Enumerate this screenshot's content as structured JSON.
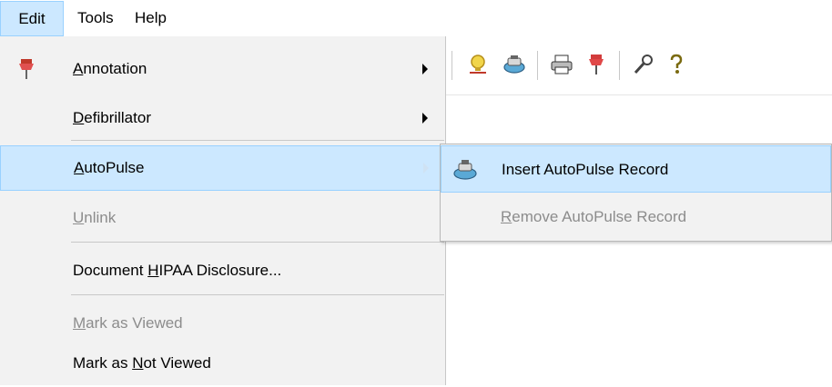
{
  "menubar": {
    "items": [
      {
        "label": "Edit"
      },
      {
        "label": "Tools"
      },
      {
        "label": "Help"
      }
    ]
  },
  "toolbar": {
    "icons": [
      "lamp-icon",
      "autopulse-device-icon",
      "print-icon",
      "pushpin-icon",
      "wrench-icon",
      "help-icon"
    ]
  },
  "edit_menu": {
    "items": [
      {
        "label": "Annotation",
        "mnemonic": "A",
        "rest": "nnotation",
        "has_submenu": true,
        "icon": "pushpin-icon"
      },
      {
        "label": "Defibrillator",
        "mnemonic": "D",
        "rest": "efibrillator",
        "has_submenu": true
      },
      {
        "label": "AutoPulse",
        "mnemonic": "A",
        "rest": "utoPulse",
        "has_submenu": true,
        "state": "highlighted"
      },
      {
        "label": "Unlink",
        "mnemonic": "U",
        "rest": "nlink",
        "state": "disabled"
      },
      {
        "label": "Document HIPAA Disclosure...",
        "pre": "Document ",
        "mnemonic": "H",
        "rest": "IPAA Disclosure..."
      },
      {
        "label": "Mark as Viewed",
        "mnemonic": "M",
        "rest": "ark as Viewed",
        "state": "disabled"
      },
      {
        "label": "Mark as Not Viewed",
        "pre": "Mark as ",
        "mnemonic": "N",
        "rest": "ot Viewed"
      }
    ]
  },
  "autopulse_submenu": {
    "items": [
      {
        "label": "Insert AutoPulse Record",
        "icon": "autopulse-device-icon",
        "state": "highlighted"
      },
      {
        "label": "Remove AutoPulse Record",
        "mnemonic": "R",
        "rest": "emove AutoPulse Record",
        "state": "disabled"
      }
    ]
  },
  "colors": {
    "highlight": "#cce8ff",
    "highlight_border": "#99d1ff",
    "menu_bg": "#f2f2f2",
    "disabled_text": "#8c8c8c"
  }
}
